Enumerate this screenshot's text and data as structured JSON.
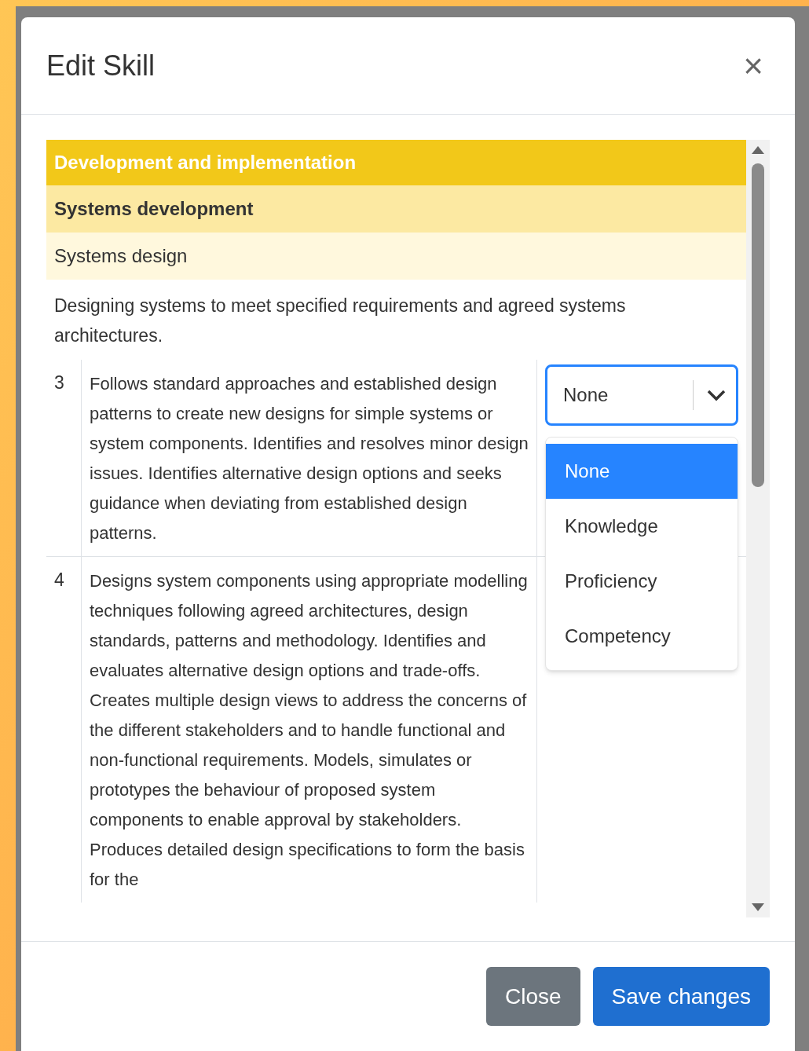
{
  "dialog": {
    "title": "Edit Skill",
    "close_symbol": "×"
  },
  "category": "Development and implementation",
  "subcategory": "Systems development",
  "skill": "Systems design",
  "description": "Designing systems to meet specified requirements and agreed systems architectures.",
  "levels": [
    {
      "level": "3",
      "text": "Follows standard approaches and established design patterns to create new designs for simple systems or system components. Identifies and resolves minor design issues. Identifies alternative design options and seeks guidance when deviating from established design patterns.",
      "select": {
        "value": "None",
        "expanded": true,
        "options": [
          {
            "label": "None",
            "selected": true
          },
          {
            "label": "Knowledge",
            "selected": false
          },
          {
            "label": "Proficiency",
            "selected": false
          },
          {
            "label": "Competency",
            "selected": false
          }
        ]
      }
    },
    {
      "level": "4",
      "text": "Designs system components using appropriate modelling techniques following agreed architectures, design standards, patterns and methodology. Identifies and evaluates alternative design options and trade-offs. Creates multiple design views to address the concerns of the different stakeholders and to handle functional and non-functional requirements. Models, simulates or prototypes the behaviour of proposed system components to enable approval by stakeholders. Produces detailed design specifications to form the basis for the"
    }
  ],
  "buttons": [
    {
      "label": "Close",
      "kind": "secondary"
    },
    {
      "label": "Save changes",
      "kind": "primary"
    }
  ]
}
